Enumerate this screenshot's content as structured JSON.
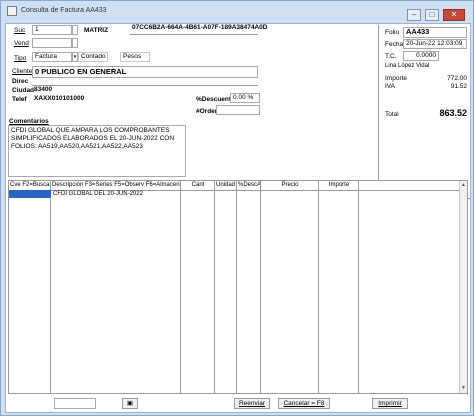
{
  "window": {
    "title": "Consulta de Factura AA433",
    "minimize_icon": "minimize-icon",
    "maximize_icon": "maximize-icon",
    "close_icon": "close-icon"
  },
  "header": {
    "suc_label": "Suc",
    "suc_value": "1",
    "suc_name": "MATRIZ",
    "uuid": "07CC6B2A-664A-4B61-A07F-189A38474A0D",
    "vend_label": "Vend",
    "vend_value": "",
    "tipo_label": "Tipo",
    "tipo_value": "Factura",
    "contado": "Contado",
    "pesos": "Pesos",
    "cliente_label": "Cliente",
    "cliente_value": "0 PUBLICO EN GENERAL",
    "direc_label": "Direc",
    "ciudad_label": "Ciudad",
    "ciudad_value": "83400",
    "telef_label": "Telef",
    "telef_value": "XAXX010101000",
    "descuent_label": "%Descuent",
    "descuent_value": "0.00 %",
    "orden_label": "#Orden",
    "orden_value": ""
  },
  "comments": {
    "label": "Comentarios",
    "text": "CFDI GLOBAL QUE AMPARA LOS COMPROBANTES SIMPLIFICADOS ELABORADOS EL 20-JUN-2022 CON FOLIOS: AA519,AA520,AA521,AA522,AA523"
  },
  "summary": {
    "folio_label": "Folio",
    "folio_value": "AA433",
    "fecha_label": "Fecha",
    "fecha_value": "20-Jun-22 12:03:09",
    "tc_label": "T.C.",
    "tc_value": "0.0000",
    "user": "Lina López Vidal",
    "importe_label": "Importe",
    "importe_value": "772.00",
    "iva_label": "IVA",
    "iva_value": "91.52",
    "total_label": "Total",
    "total_value": "863.52"
  },
  "grid": {
    "headers": [
      "Cve F2=Busca",
      "Descripción  F3=Series F5=Observ F6=Almacen",
      "Cant",
      "Unidad",
      "%DescA",
      "Precio",
      "Importe"
    ],
    "rows": [
      {
        "cve": "",
        "descripcion": "CFDI GLOBAL DEL 20-JUN-2022",
        "cant": "",
        "unidad": "",
        "desc": "",
        "precio": "",
        "importe": ""
      }
    ]
  },
  "footer": {
    "reenviar": "Reenviar",
    "cancelar": "Cancelar = F8",
    "imprimir": "Imprimir",
    "image_icon": "picture-icon"
  }
}
